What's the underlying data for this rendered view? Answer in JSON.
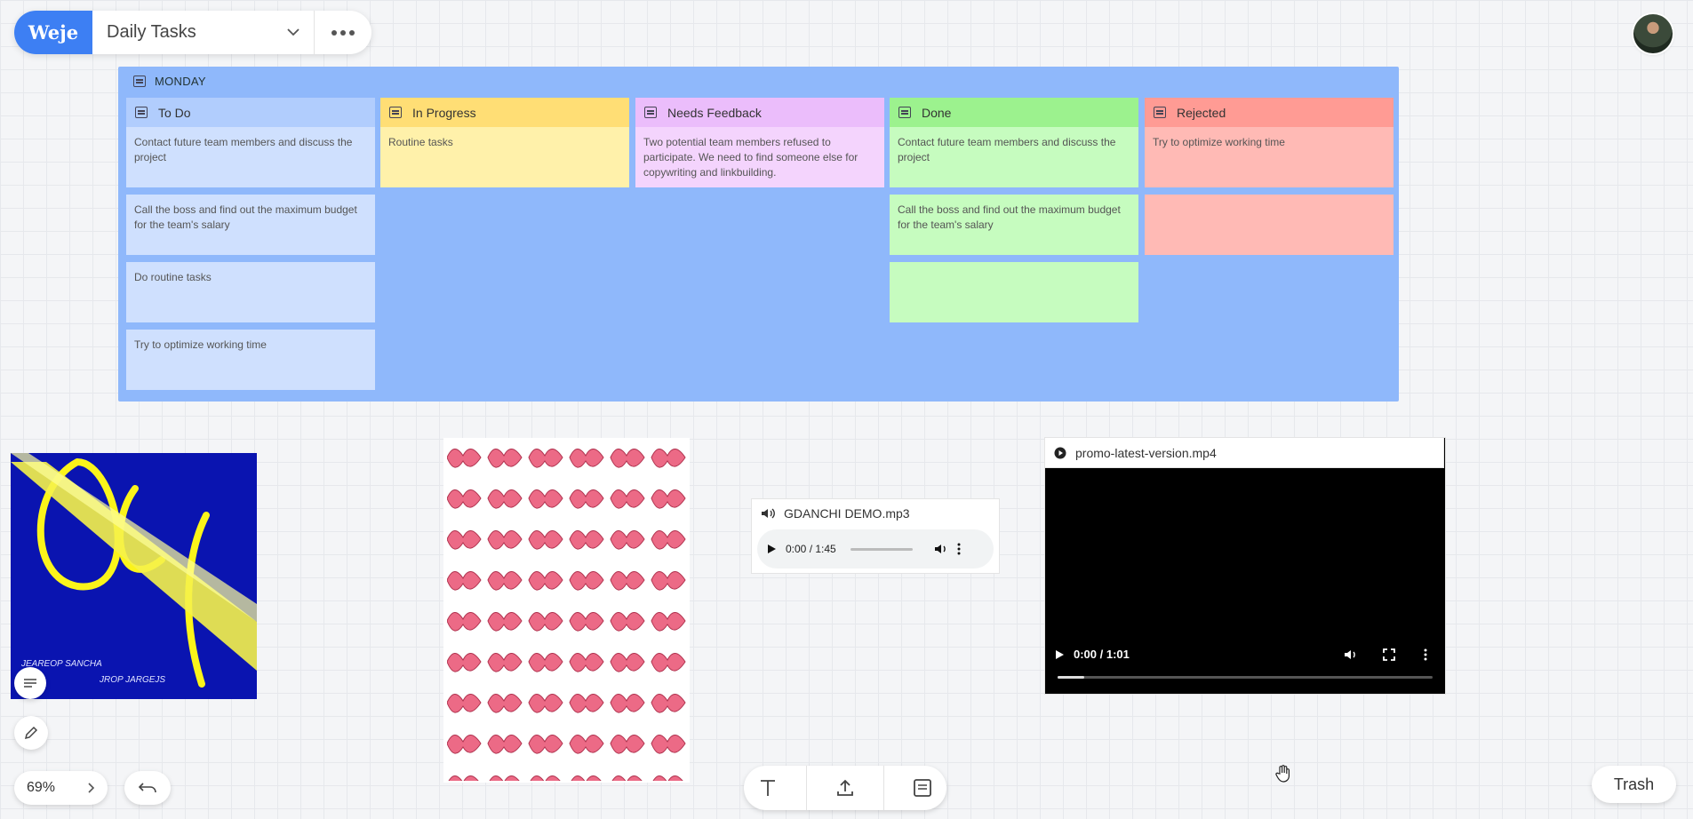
{
  "app": {
    "logo": "Weje",
    "board_name": "Daily Tasks"
  },
  "group": {
    "title": "MONDAY"
  },
  "columns": [
    {
      "title": "To Do",
      "cards": [
        "Contact future team members and discuss the project",
        "Call the boss and find out the maximum budget for the team's salary",
        "Do routine tasks",
        "Try to optimize working time"
      ]
    },
    {
      "title": "In Progress",
      "cards": [
        "Routine tasks"
      ]
    },
    {
      "title": "Needs Feedback",
      "cards": [
        "Two potential team members refused to participate. We need to find someone else for copywriting and linkbuilding."
      ]
    },
    {
      "title": "Done",
      "cards": [
        "Contact future team members and discuss the project",
        "Call the boss and find out the maximum budget for the team's salary",
        ""
      ]
    },
    {
      "title": "Rejected",
      "cards": [
        "Try to optimize working time",
        ""
      ]
    }
  ],
  "colors": {
    "todo_head": "#b1cdfd",
    "todo_card": "#cfe0fe",
    "progress_head": "#ffde75",
    "progress_card": "#fff1aa",
    "feedback_head": "#ebbdfb",
    "feedback_card": "#f4d4fd",
    "done_head": "#9cf28e",
    "done_card": "#c6fcbf",
    "rejected_head": "#ff9b94",
    "rejected_card": "#ffbab5"
  },
  "image1": {
    "caption_left": "JEAREOP SANCHA",
    "caption_right": "JROP JARGEJS"
  },
  "audio": {
    "filename": "GDANCHI DEMO.mp3",
    "time": "0:00 / 1:45"
  },
  "video": {
    "filename": "promo-latest-version.mp4",
    "time": "0:00 / 1:01"
  },
  "zoom": {
    "value": "69%"
  },
  "trash": {
    "label": "Trash"
  }
}
